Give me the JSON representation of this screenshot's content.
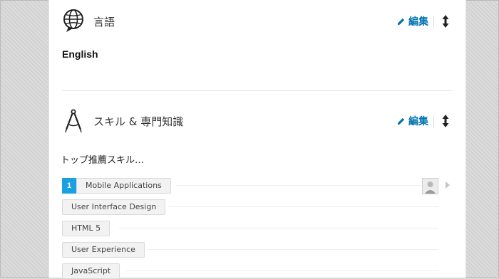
{
  "languages": {
    "title": "言語",
    "edit_label": "編集",
    "items": [
      "English"
    ]
  },
  "skills": {
    "title": "スキル & 専門知識",
    "edit_label": "編集",
    "top_label": "トップ推薦スキル…",
    "items": [
      {
        "rank": "1",
        "name": "Mobile Applications"
      },
      {
        "name": "User Interface Design"
      },
      {
        "name": "HTML 5"
      },
      {
        "name": "User Experience"
      },
      {
        "name": "JavaScript"
      }
    ]
  },
  "icons": {
    "languages": "globe-speech-icon",
    "skills": "compass-icon",
    "edit": "pencil-icon",
    "reorder": "up-down-arrow-icon"
  },
  "colors": {
    "accent": "#0073b1",
    "rank_badge": "#1aa1e1"
  }
}
